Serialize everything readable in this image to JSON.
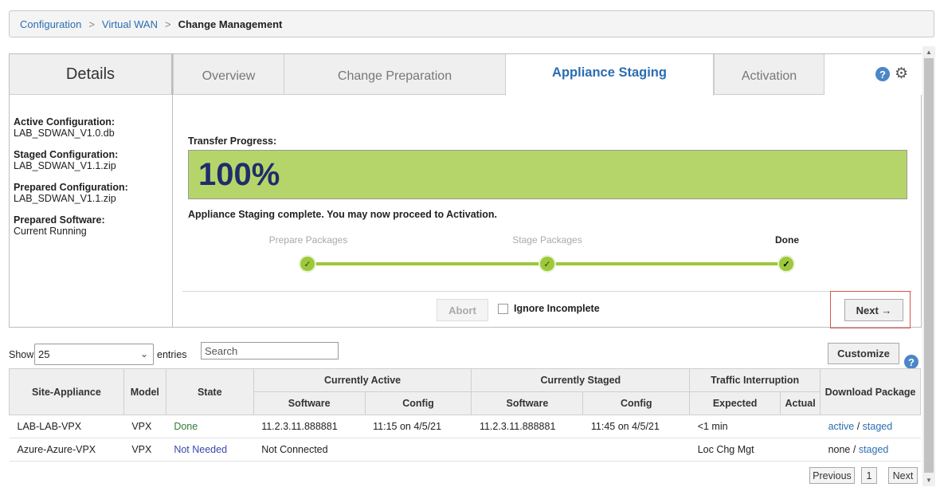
{
  "breadcrumb": {
    "items": [
      "Configuration",
      "Virtual WAN"
    ],
    "current": "Change Management"
  },
  "details": {
    "title": "Details",
    "fields": [
      {
        "label": "Active Configuration:",
        "value": "LAB_SDWAN_V1.0.db"
      },
      {
        "label": "Staged Configuration:",
        "value": "LAB_SDWAN_V1.1.zip"
      },
      {
        "label": "Prepared Configuration:",
        "value": "LAB_SDWAN_V1.1.zip"
      },
      {
        "label": "Prepared Software:",
        "value": "Current Running"
      }
    ]
  },
  "tabs": [
    {
      "label": "Overview",
      "active": false
    },
    {
      "label": "Change Preparation",
      "active": false
    },
    {
      "label": "Appliance Staging",
      "active": true
    },
    {
      "label": "Activation",
      "active": false
    }
  ],
  "icons": {
    "help": "help-icon",
    "settings": "gear-icon"
  },
  "staging": {
    "transfer_label": "Transfer Progress:",
    "progress_percent": 100,
    "progress_text": "100%",
    "status_message": "Appliance Staging complete. You may now proceed to Activation.",
    "steps": [
      {
        "label": "Prepare Packages",
        "state": "complete"
      },
      {
        "label": "Stage Packages",
        "state": "complete"
      },
      {
        "label": "Done",
        "state": "current"
      }
    ],
    "check_glyph": "✓",
    "abort_label": "Abort",
    "ignore_label": "Ignore Incomplete",
    "ignore_checked": false,
    "next_label": "Next →"
  },
  "table_controls": {
    "show_label": "Show",
    "page_size": "25",
    "entries_label": "entries",
    "search_placeholder": "Search",
    "customize_label": "Customize"
  },
  "table": {
    "headers": {
      "site_appliance": "Site-Appliance",
      "model": "Model",
      "state": "State",
      "currently_active": "Currently Active",
      "currently_staged": "Currently Staged",
      "traffic_interruption": "Traffic Interruption",
      "download_package": "Download Package",
      "software": "Software",
      "config": "Config",
      "expected": "Expected",
      "actual": "Actual"
    },
    "rows": [
      {
        "site": "LAB-LAB-VPX",
        "model": "VPX",
        "state": "Done",
        "active_software": "11.2.3.11.888881",
        "active_config": "11:15 on 4/5/21",
        "staged_software": "11.2.3.11.888881",
        "staged_config": "11:45 on 4/5/21",
        "expected": "<1 min",
        "actual": "",
        "download_a": "active",
        "download_sep": "/",
        "download_b": "staged"
      },
      {
        "site": "Azure-Azure-VPX",
        "model": "VPX",
        "state": "Not Needed",
        "active_software": "Not Connected",
        "active_config": "",
        "staged_software": "",
        "staged_config": "",
        "expected": "Loc Chg Mgt",
        "actual": "",
        "download_a": "none",
        "download_sep": "/",
        "download_b": "staged"
      }
    ]
  },
  "pagination": {
    "previous": "Previous",
    "page": "1",
    "next": "Next"
  },
  "colors": {
    "accent": "#2a6eb0",
    "progress_fill": "#b5d56b",
    "step_green": "#9cc83a",
    "highlight_red": "#d9534f"
  }
}
